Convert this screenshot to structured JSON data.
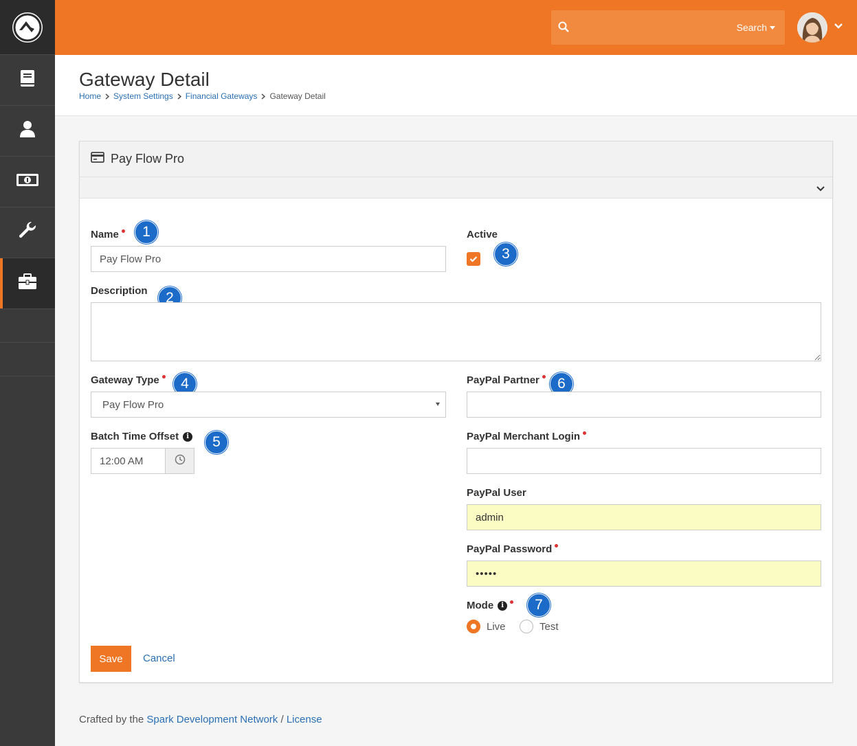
{
  "app": {
    "name": "Rock RMS"
  },
  "colors": {
    "accent": "#ee7625",
    "link": "#2a6fb4",
    "badge": "#1c6bc9",
    "sidebar": "#3a3a3a"
  },
  "sidebar": {
    "items": [
      {
        "icon": "book-icon"
      },
      {
        "icon": "person-icon"
      },
      {
        "icon": "money-icon"
      },
      {
        "icon": "wrench-icon"
      },
      {
        "icon": "briefcase-icon",
        "active": true
      }
    ]
  },
  "header": {
    "search": {
      "placeholder": "",
      "button_label": "Search"
    }
  },
  "page": {
    "title": "Gateway Detail",
    "breadcrumb": [
      "Home",
      "System Settings",
      "Financial Gateways",
      "Gateway Detail"
    ]
  },
  "panel": {
    "title": "Pay Flow Pro",
    "fields": {
      "name": {
        "label": "Name",
        "value": "Pay Flow Pro"
      },
      "active": {
        "label": "Active",
        "checked": true
      },
      "description": {
        "label": "Description",
        "value": ""
      },
      "gateway_type": {
        "label": "Gateway Type",
        "value": "Pay Flow Pro"
      },
      "batch_time_offset": {
        "label": "Batch Time Offset",
        "value": "12:00 AM"
      },
      "paypal_partner": {
        "label": "PayPal Partner",
        "value": ""
      },
      "paypal_merchant_login": {
        "label": "PayPal Merchant Login",
        "value": ""
      },
      "paypal_user": {
        "label": "PayPal User",
        "value": "admin"
      },
      "paypal_password": {
        "label": "PayPal Password",
        "value": "•••••"
      },
      "mode": {
        "label": "Mode",
        "options": [
          "Live",
          "Test"
        ],
        "selected": "Live"
      }
    },
    "badges": [
      "1",
      "2",
      "3",
      "4",
      "5",
      "6",
      "7"
    ],
    "actions": {
      "save": "Save",
      "cancel": "Cancel"
    }
  },
  "footer": {
    "prefix": "Crafted by the",
    "link1": "Spark Development Network",
    "sep": "/",
    "link2": "License"
  }
}
